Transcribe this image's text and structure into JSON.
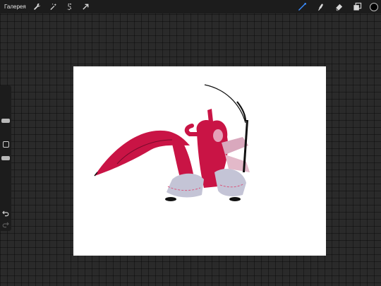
{
  "topbar": {
    "gallery_label": "Галерея",
    "left_tools": [
      {
        "icon": "wrench-icon",
        "name": "actions"
      },
      {
        "icon": "magic-wand-icon",
        "name": "adjustments"
      },
      {
        "icon": "selection-s-icon",
        "name": "selection"
      },
      {
        "icon": "arrow-cursor-icon",
        "name": "transform"
      }
    ],
    "right_tools": [
      {
        "icon": "brush-icon",
        "name": "brush",
        "active": true
      },
      {
        "icon": "smudge-icon",
        "name": "smudge"
      },
      {
        "icon": "eraser-icon",
        "name": "eraser"
      },
      {
        "icon": "layers-icon",
        "name": "layers"
      }
    ],
    "current_color": "#000000",
    "active_tool_color": "#3b8cff"
  },
  "sidebar": {
    "brush_size": 0.24,
    "opacity": 0.52,
    "undo_icon": "undo-arrow-icon",
    "redo_icon": "redo-arrow-icon"
  },
  "canvas": {
    "background": "#ffffff",
    "palette": [
      "#c91445",
      "#d9a8bd",
      "#c4c4d6",
      "#111111"
    ]
  }
}
